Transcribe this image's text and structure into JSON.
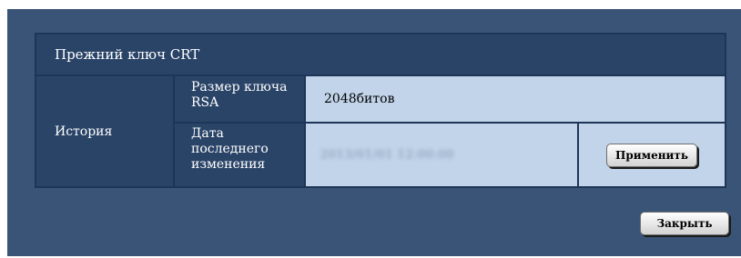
{
  "panel": {
    "title": "Прежний ключ CRT"
  },
  "history": {
    "label": "История",
    "rsa_key_size": {
      "label": "Размер ключа RSA",
      "value": "2048битов"
    },
    "last_modified": {
      "label": "Дата последнего изменения",
      "value": "2013/01/01 12:00:00"
    }
  },
  "buttons": {
    "apply": "Применить",
    "close": "Закрыть"
  }
}
